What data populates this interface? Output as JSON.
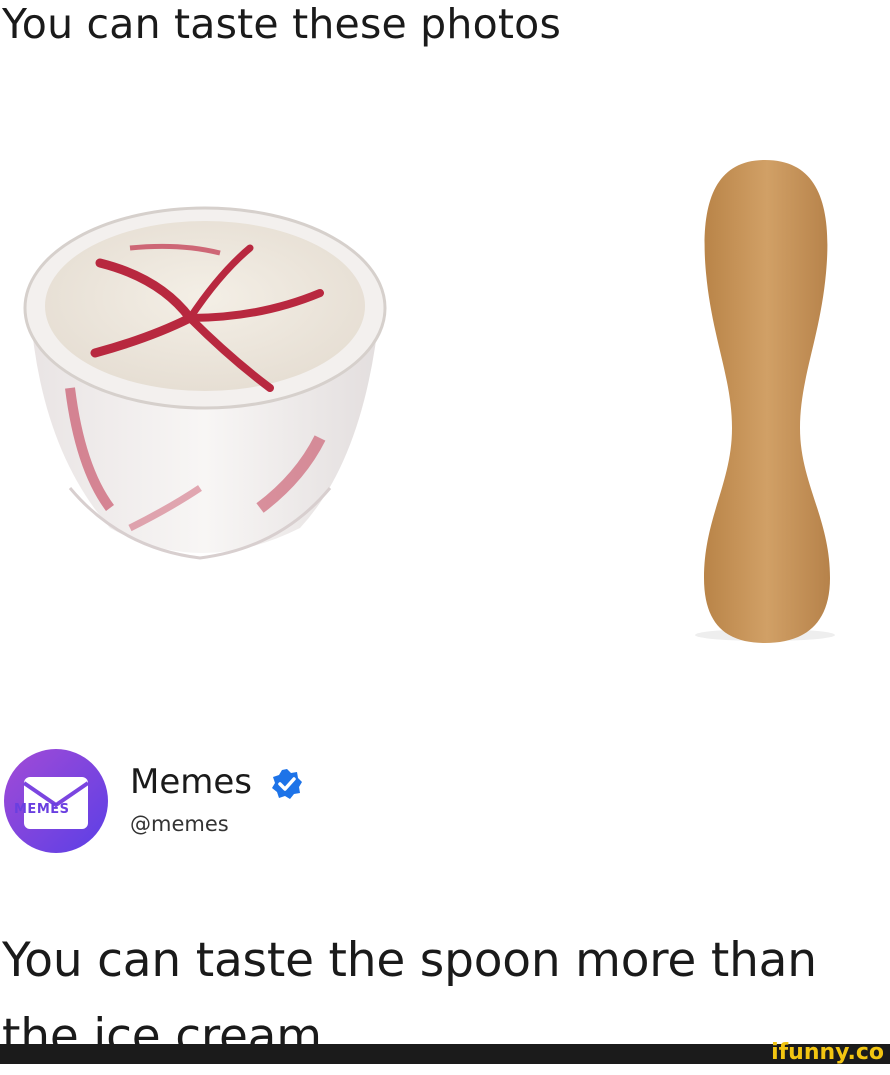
{
  "post": {
    "title": "You can taste these photos"
  },
  "tweet": {
    "avatar_text": "MEMES",
    "display_name": "Memes",
    "handle": "@memes",
    "text": "You can taste the spoon more than the ice cream",
    "verified": true
  },
  "watermark": {
    "text": "ifunny.co"
  },
  "colors": {
    "avatar_gradient_start": "#a24bd6",
    "avatar_gradient_end": "#5b3fe6",
    "verified_blue": "#1d73e8",
    "spoon": "#c9975a",
    "ice_cream_swirl": "#c0304a"
  },
  "icons": [
    "verified-icon",
    "memes-logo"
  ]
}
